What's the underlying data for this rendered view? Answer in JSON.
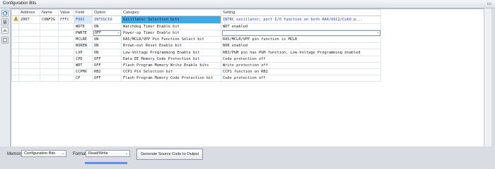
{
  "window": {
    "title": "Configuration Bits"
  },
  "toolbar": {
    "icons": [
      "refresh-icon",
      "program-icon",
      "read-icon",
      "clear-icon"
    ]
  },
  "table": {
    "headers": [
      "",
      "Address",
      "Name",
      "Value",
      "Field",
      "Option",
      "Category",
      "Setting"
    ],
    "rows": [
      {
        "address": "2007",
        "name": "CONFIG",
        "value": "FFFC",
        "field": "FOSC",
        "option": "INTOSCIO",
        "category": "Oscillator Selection bits",
        "setting": "INTRC oscillator; port I/O function on both RA4/OSC2/CLKO p...",
        "warn": true,
        "selected": true
      },
      {
        "address": "",
        "name": "",
        "value": "",
        "field": "WDTE",
        "option": "ON",
        "category": "Watchdog Timer Enable bit",
        "setting": "WDT enabled"
      },
      {
        "address": "",
        "name": "",
        "value": "",
        "field": "PWRTE",
        "option": "OFF",
        "category": "Power-up Timer Enable bit",
        "setting": "",
        "dropdowns": true
      },
      {
        "address": "",
        "name": "",
        "value": "",
        "field": "MCLRE",
        "option": "ON",
        "category": "RA5/MCLR/VPP Pin Function Select bit",
        "setting": "RA5/MCLR/VPP pin function is MCLR"
      },
      {
        "address": "",
        "name": "",
        "value": "",
        "field": "BOREN",
        "option": "ON",
        "category": "Brown-out Reset Enable bit",
        "setting": "BOR enabled"
      },
      {
        "address": "",
        "name": "",
        "value": "",
        "field": "LVP",
        "option": "ON",
        "category": "Low-Voltage Programming Enable bit",
        "setting": "RB3/PGM pin has PGM function, Low-Voltage Programming enabled"
      },
      {
        "address": "",
        "name": "",
        "value": "",
        "field": "CPD",
        "option": "OFF",
        "category": "Data EE Memory Code Protection bit",
        "setting": "Code protection off"
      },
      {
        "address": "",
        "name": "",
        "value": "",
        "field": "WRT",
        "option": "OFF",
        "category": "Flash Program Memory Write Enable bits",
        "setting": "Write protection off"
      },
      {
        "address": "",
        "name": "",
        "value": "",
        "field": "CCPMX",
        "option": "RB2",
        "category": "CCP1 Pin Selection bit",
        "setting": "CCP1 function on RB2"
      },
      {
        "address": "",
        "name": "",
        "value": "",
        "field": "CP",
        "option": "OFF",
        "category": "Flash Program Memory Code Protection bit",
        "setting": "Code protection off"
      }
    ]
  },
  "bottom": {
    "memory_label": "Memory",
    "memory_value": "Configuration Bits",
    "format_label": "Format",
    "format_value": "Read/Write",
    "generate_label": "Generate Source Code to Output"
  }
}
